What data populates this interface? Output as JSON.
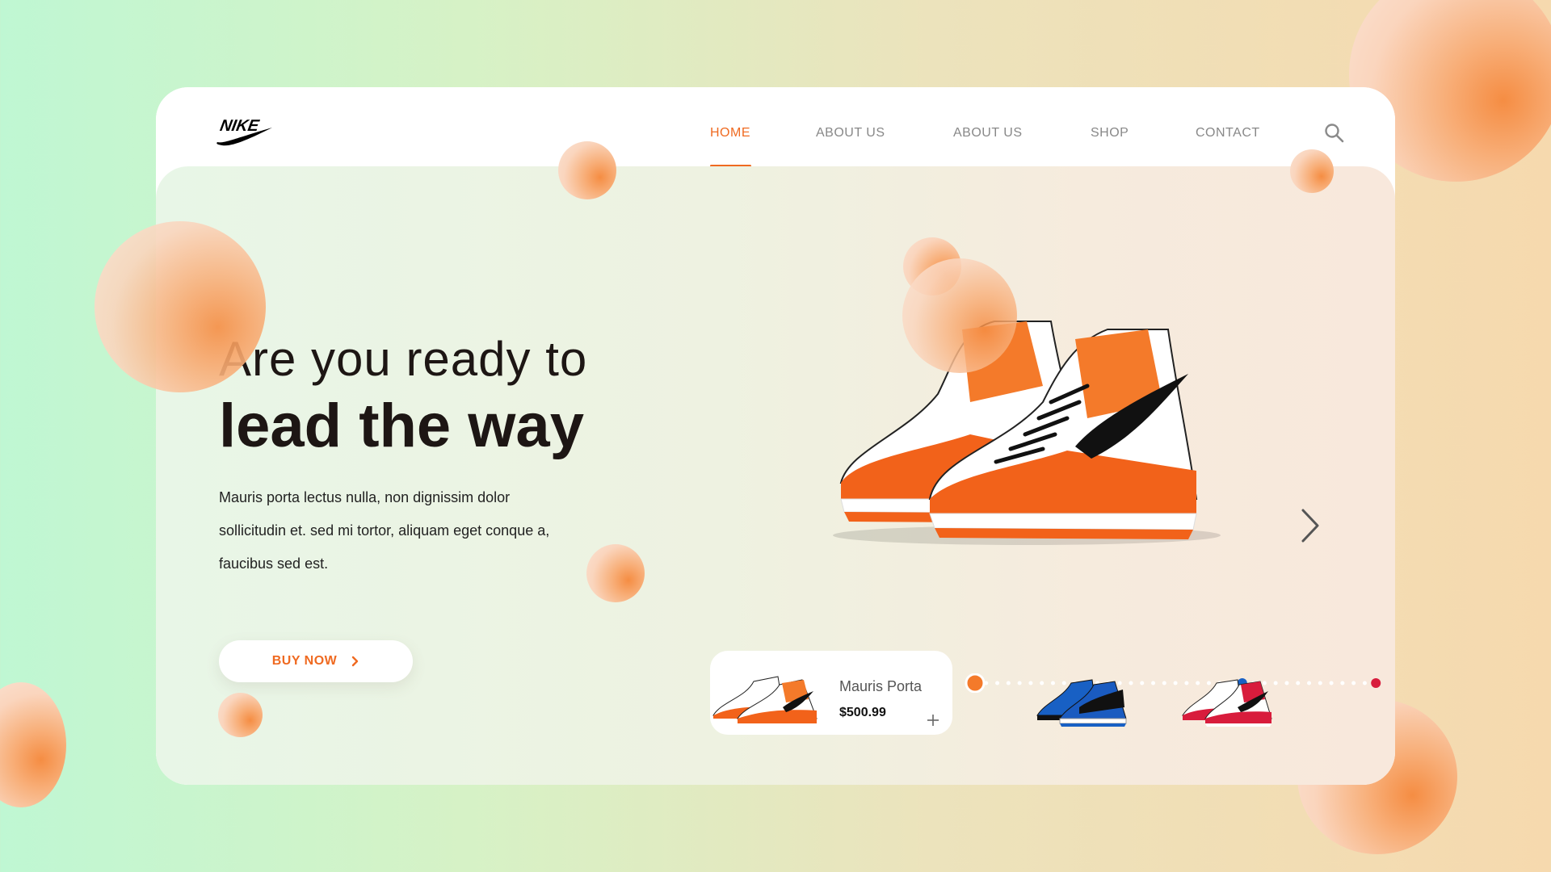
{
  "brand": {
    "name": "NIKE",
    "logo_icon": "nike-swoosh-icon",
    "accent": "#ef6a21"
  },
  "nav": {
    "links": [
      {
        "label": "HOME",
        "active": true
      },
      {
        "label": "ABOUT US",
        "active": false
      },
      {
        "label": "ABOUT US",
        "active": false
      },
      {
        "label": "SHOP",
        "active": false
      },
      {
        "label": "CONTACT",
        "active": false
      }
    ],
    "search_icon": "search-icon"
  },
  "hero": {
    "headline_line1": "Are you ready to",
    "headline_line2": "lead the way",
    "description": "Mauris porta lectus nulla, non dignissim dolor sollicitudin et. sed mi tortor, aliquam eget conque a, faucibus sed est.",
    "cta_label": "BUY NOW",
    "next_icon": "chevron-right-icon"
  },
  "carousel": {
    "dots_total": 38,
    "active_index": 0,
    "color_markers": [
      {
        "index": 0,
        "color": "#f47a2a"
      },
      {
        "index": 24,
        "color": "#1860c4"
      },
      {
        "index": 36,
        "color": "#d81c3c"
      }
    ]
  },
  "product_card": {
    "name": "Mauris Porta",
    "price": "$500.99",
    "add_icon": "plus-icon"
  },
  "thumbnails": [
    {
      "colorway": "orange"
    },
    {
      "colorway": "blue"
    },
    {
      "colorway": "red"
    }
  ]
}
